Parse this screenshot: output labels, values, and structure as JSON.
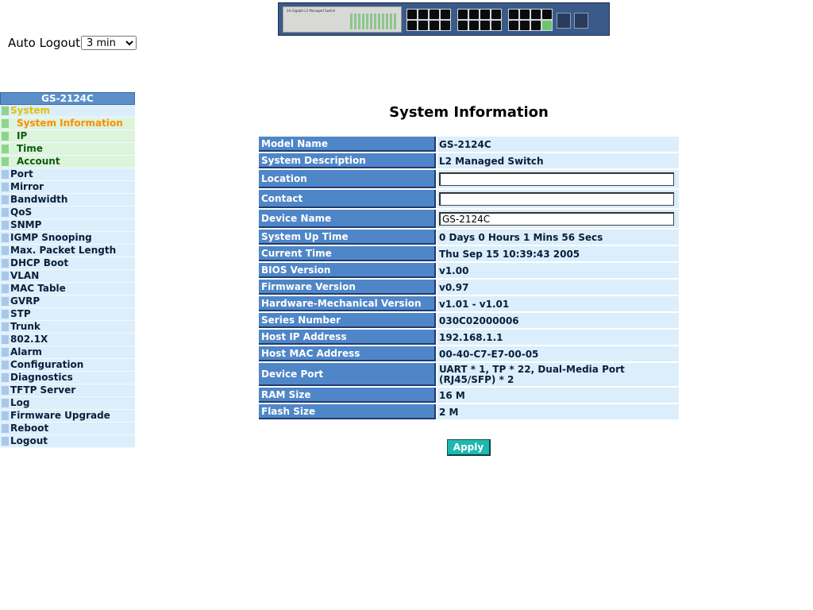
{
  "banner": {
    "brand_text": "24-Gigabit L2 Managed Switch"
  },
  "auto_logout": {
    "label": "Auto Logout",
    "selected": "3 min"
  },
  "sidebar": {
    "header": "GS-2124C",
    "items": [
      {
        "label": "System"
      },
      {
        "label": "System Information"
      },
      {
        "label": "IP"
      },
      {
        "label": "Time"
      },
      {
        "label": "Account"
      },
      {
        "label": "Port"
      },
      {
        "label": "Mirror"
      },
      {
        "label": "Bandwidth"
      },
      {
        "label": "QoS"
      },
      {
        "label": "SNMP"
      },
      {
        "label": "IGMP Snooping"
      },
      {
        "label": "Max. Packet Length"
      },
      {
        "label": "DHCP Boot"
      },
      {
        "label": "VLAN"
      },
      {
        "label": "MAC Table"
      },
      {
        "label": "GVRP"
      },
      {
        "label": "STP"
      },
      {
        "label": "Trunk"
      },
      {
        "label": "802.1X"
      },
      {
        "label": "Alarm"
      },
      {
        "label": "Configuration"
      },
      {
        "label": "Diagnostics"
      },
      {
        "label": "TFTP Server"
      },
      {
        "label": "Log"
      },
      {
        "label": "Firmware Upgrade"
      },
      {
        "label": "Reboot"
      },
      {
        "label": "Logout"
      }
    ]
  },
  "page": {
    "title": "System Information"
  },
  "info": {
    "rows": [
      {
        "label": "Model Name",
        "value": "GS-2124C"
      },
      {
        "label": "System Description",
        "value": "L2 Managed Switch"
      },
      {
        "label": "Location",
        "value": ""
      },
      {
        "label": "Contact",
        "value": ""
      },
      {
        "label": "Device Name",
        "value": "GS-2124C"
      },
      {
        "label": "System Up Time",
        "value": "0 Days 0 Hours 1 Mins 56 Secs"
      },
      {
        "label": "Current Time",
        "value": "Thu Sep 15 10:39:43 2005"
      },
      {
        "label": "BIOS Version",
        "value": "v1.00"
      },
      {
        "label": "Firmware Version",
        "value": "v0.97"
      },
      {
        "label": "Hardware-Mechanical Version",
        "value": "v1.01 - v1.01"
      },
      {
        "label": "Series Number",
        "value": "030C02000006"
      },
      {
        "label": "Host IP Address",
        "value": "192.168.1.1"
      },
      {
        "label": "Host MAC Address",
        "value": "00-40-C7-E7-00-05"
      },
      {
        "label": "Device Port",
        "value_line1": "UART * 1, TP * 22, Dual-Media Port",
        "value_line2": "(RJ45/SFP) * 2"
      },
      {
        "label": "RAM Size",
        "value": "16 M"
      },
      {
        "label": "Flash Size",
        "value": "2 M"
      }
    ]
  },
  "apply_label": "Apply",
  "colors": {
    "label_bg": "#4f86c8",
    "value_bg": "#dceefb",
    "apply_bg": "#1fb8b0",
    "active_menu": "#ff8c00",
    "system_menu": "#e0c400"
  }
}
